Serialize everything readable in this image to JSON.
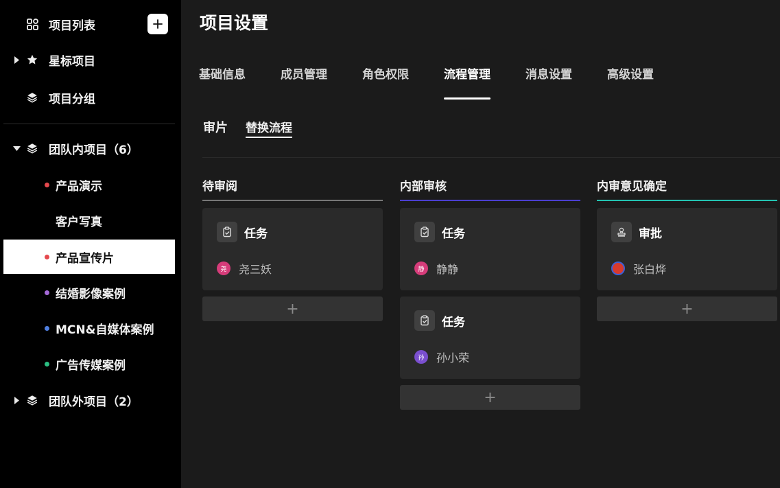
{
  "sidebar": {
    "project_list": "项目列表",
    "starred": "星标项目",
    "groups": "项目分组",
    "team_inside": "团队内项目（6）",
    "team_inside_items": [
      {
        "label": "产品演示",
        "dot": "#e5484d"
      },
      {
        "label": "客户写真",
        "dot": ""
      },
      {
        "label": "产品宣传片",
        "dot": "#e5484d"
      },
      {
        "label": "结婚影像案例",
        "dot": "#a56ad8"
      },
      {
        "label": "MCN&自媒体案例",
        "dot": "#4f7fe0"
      },
      {
        "label": "广告传媒案例",
        "dot": "#2bbf83"
      }
    ],
    "team_outside": "团队外项目（2）"
  },
  "main": {
    "title": "项目设置",
    "tabs": [
      "基础信息",
      "成员管理",
      "角色权限",
      "流程管理",
      "消息设置",
      "高级设置"
    ],
    "active_tab": "流程管理",
    "subtabs": [
      "审片",
      "替换流程"
    ],
    "active_subtab": "替换流程",
    "columns": [
      {
        "title": "待审阅",
        "line_color": "#777777",
        "cards": [
          {
            "type": "任务",
            "icon": "clipboard-check-icon",
            "user": "尧三妖",
            "avatar_text": "尧",
            "avatar_color": "#d63c7a"
          }
        ]
      },
      {
        "title": "内部审核",
        "line_color": "#4b3fd1",
        "cards": [
          {
            "type": "任务",
            "icon": "clipboard-check-icon",
            "user": "静静",
            "avatar_text": "静",
            "avatar_color": "#d63c7a"
          },
          {
            "type": "任务",
            "icon": "clipboard-check-icon",
            "user": "孙小荣",
            "avatar_text": "孙",
            "avatar_color": "#7a4fcf"
          }
        ]
      },
      {
        "title": "内审意见确定",
        "line_color": "#23c2b0",
        "cards": [
          {
            "type": "审批",
            "icon": "stamp-icon",
            "user": "张白烨",
            "avatar_text": "",
            "avatar_color": "#d83a2e"
          }
        ]
      }
    ]
  }
}
